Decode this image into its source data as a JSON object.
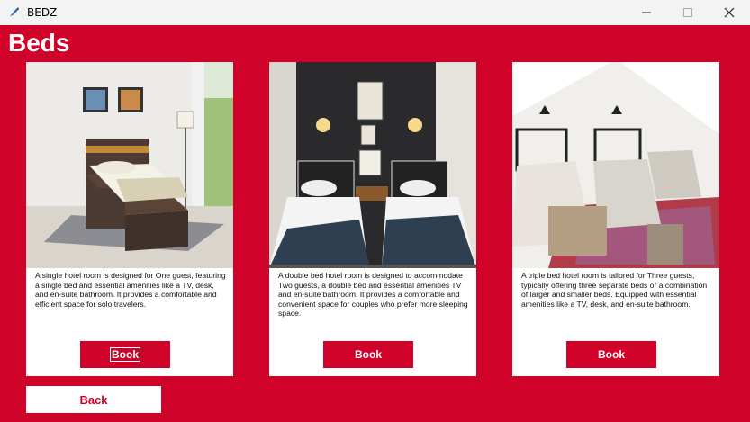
{
  "window": {
    "title": "BEDZ"
  },
  "page": {
    "title": "Beds"
  },
  "rooms": [
    {
      "description": "A single hotel room is designed for One guest, featuring a single bed and essential amenities like a TV, desk, and en-suite bathroom. It provides a comfortable and efficient space for solo travelers.",
      "book_label": "Book"
    },
    {
      "description": "A double bed hotel room is designed to accommodate Two guests, a double bed and essential amenities TV and en-suite bathroom. It provides a comfortable and convenient space for couples who prefer more sleeping space.",
      "book_label": "Book"
    },
    {
      "description": "A triple bed hotel room is tailored for Three guests, typically offering three separate beds or a combination of larger and smaller beds. Equipped with essential amenities like a TV, desk, and en-suite bathroom.",
      "book_label": "Book"
    }
  ],
  "back_label": "Back",
  "colors": {
    "accent": "#d0022a",
    "titlebar": "#f3f3f3"
  }
}
